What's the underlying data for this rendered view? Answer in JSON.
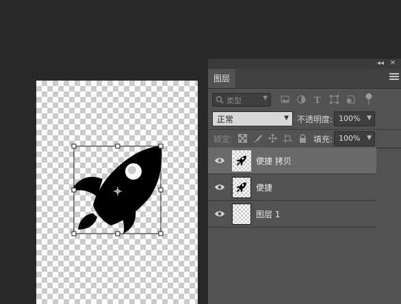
{
  "panel": {
    "tab_label": "图层",
    "collapse_glyph": "◂◂",
    "close_glyph": "✕",
    "filter": {
      "label": "类型",
      "value": ""
    },
    "blend_mode": "正常",
    "opacity_label": "不透明度:",
    "opacity_value": "100%",
    "lock_label": "锁定:",
    "fill_label": "填充:",
    "fill_value": "100%"
  },
  "layers": [
    {
      "name": "便捷 拷贝",
      "visible": true,
      "selected": true,
      "thumb": "rocket"
    },
    {
      "name": "便捷",
      "visible": true,
      "selected": false,
      "thumb": "rocket"
    },
    {
      "name": "图层 1",
      "visible": true,
      "selected": false,
      "thumb": "empty"
    }
  ],
  "icons": {
    "filter": [
      "image-filter-icon",
      "adjustment-filter-icon",
      "type-filter-icon",
      "shape-filter-icon",
      "smart-object-filter-icon",
      "filter-toggle-icon"
    ],
    "lock": [
      "lock-transparent-pixels-icon",
      "lock-image-pixels-icon",
      "lock-position-icon",
      "lock-artboard-icon",
      "lock-all-icon"
    ]
  },
  "colors": {
    "workspace": "#2a272b",
    "panel": "#535153",
    "selected_layer": "#6a686a"
  }
}
